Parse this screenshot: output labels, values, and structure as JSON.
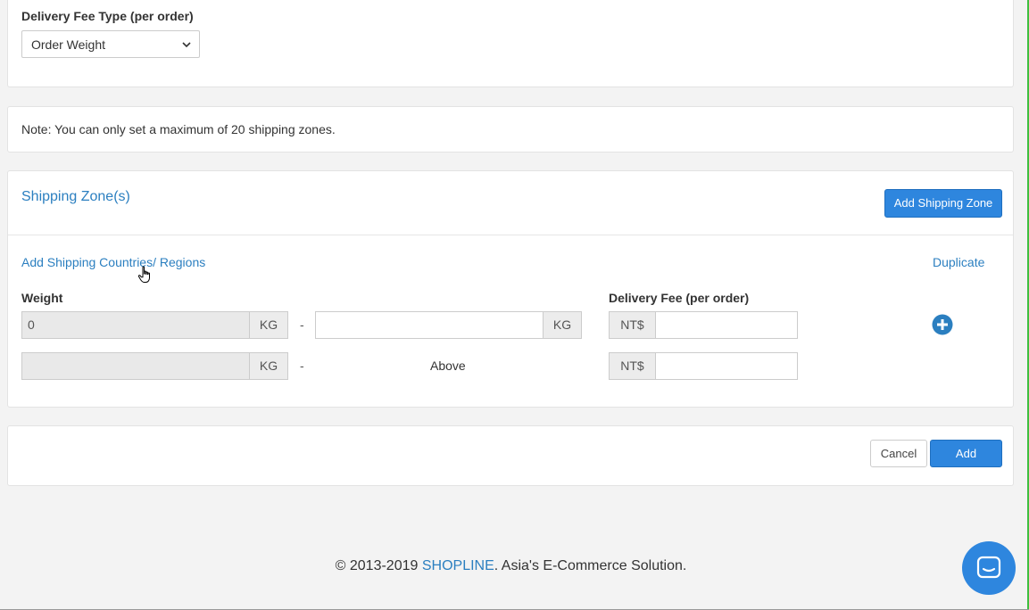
{
  "fee_type": {
    "label": "Delivery Fee Type (per order)",
    "selected": "Order Weight"
  },
  "note": {
    "text": "Note: You can only set a maximum of 20 shipping zones."
  },
  "zones": {
    "title": "Shipping Zone(s)",
    "add_zone_button": "Add Shipping Zone",
    "add_regions_link": "Add Shipping Countries/ Regions",
    "duplicate_link": "Duplicate",
    "weight_label": "Weight",
    "fee_label": "Delivery Fee (per order)",
    "rows": [
      {
        "from_value": "0",
        "from_unit": "KG",
        "separator": "-",
        "to_value": "",
        "to_unit": "KG",
        "currency": "NT$",
        "fee_value": ""
      },
      {
        "from_value": "",
        "from_unit": "KG",
        "separator": "-",
        "to_text": "Above",
        "currency": "NT$",
        "fee_value": ""
      }
    ]
  },
  "actions": {
    "cancel": "Cancel",
    "add": "Add"
  },
  "footer": {
    "prefix": "© 2013-2019 ",
    "brand": "SHOPLINE",
    "suffix": ". Asia's E-Commerce Solution."
  },
  "colors": {
    "accent": "#2e86de",
    "link": "#2b7fc0"
  },
  "icons": {
    "select": "chevron-down-icon",
    "add_row": "plus-circle-icon",
    "chat": "chat-icon",
    "cursor": "hand-pointer-icon"
  }
}
